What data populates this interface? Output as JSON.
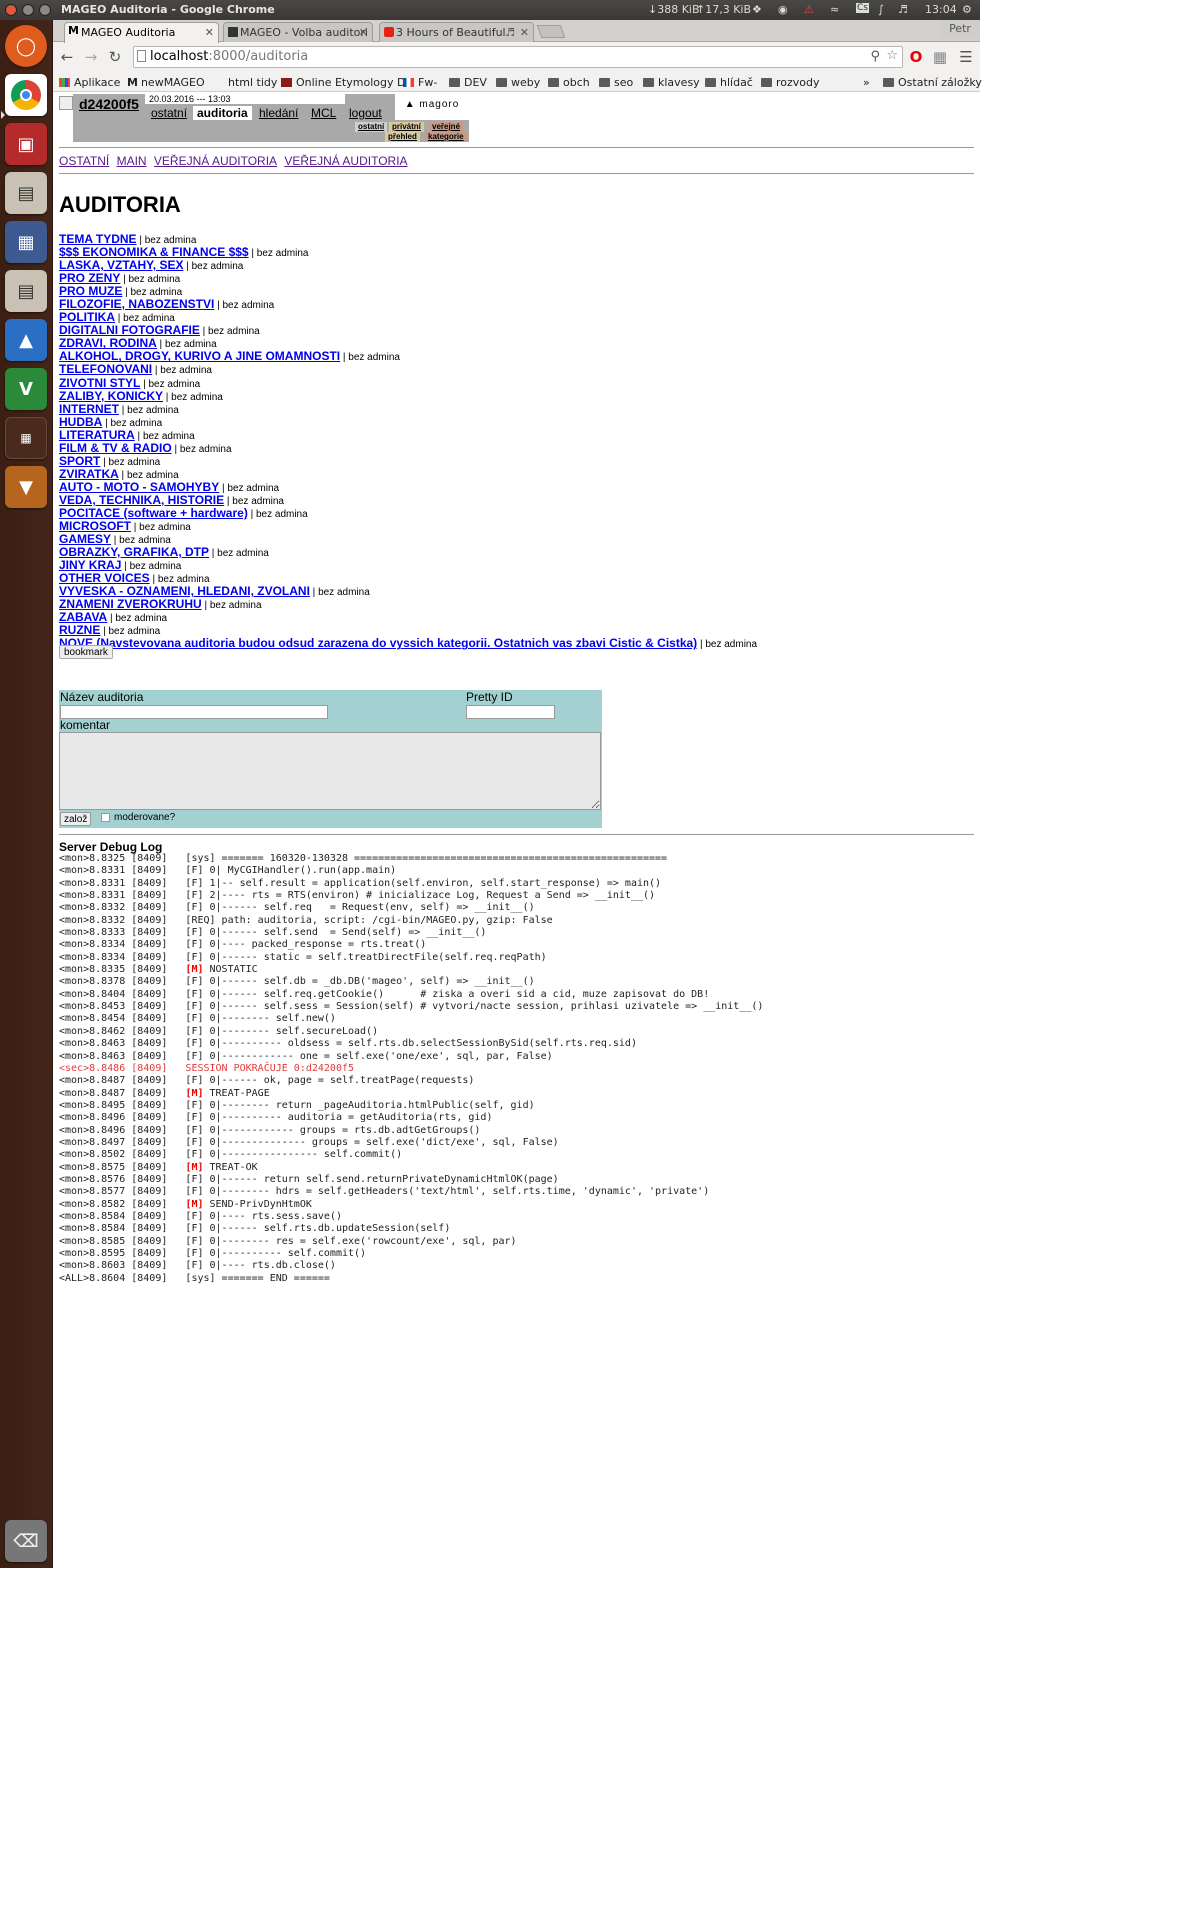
{
  "os": {
    "window_title": "MAGEO Auditoria - Google Chrome",
    "net_down": "↓388 KiB",
    "net_up": "↑17,3 KiB",
    "clock": "13:04"
  },
  "browser": {
    "tabs": [
      {
        "label": "MAGEO Auditoria",
        "active": true
      },
      {
        "label": "MAGEO - Volba auditori",
        "active": false
      },
      {
        "label": "3 Hours of Beautiful",
        "active": false
      }
    ],
    "profile": "Petr",
    "url_host": "localhost",
    "url_path": ":8000/auditoria",
    "bookmarks": [
      "Aplikace",
      "newMAGEO",
      "html tidy",
      "Online Etymology D",
      "Fw-",
      "DEV",
      "weby",
      "obch",
      "seo",
      "klavesy",
      "hlídač",
      "rozvody"
    ],
    "bookmarks_more": "»",
    "other_bookmarks": "Ostatní záložky"
  },
  "header": {
    "sid": "d24200f5",
    "datetime": "20.03.2016 --- 13:03",
    "tabs": [
      "ostatní",
      "auditoria",
      "hledání",
      "MCL",
      "logout"
    ],
    "active_tab": "auditoria",
    "logo": "magoro",
    "sub_links": [
      "ostatní",
      "privátní",
      "veřejné",
      "přehled",
      "kategorie"
    ]
  },
  "breadcrumbs": [
    "OSTATNÍ",
    "MAIN",
    "VEŘEJNÁ AUDITORIA",
    "VEŘEJNÁ AUDITORIA"
  ],
  "page_title": "AUDITORIA",
  "admin_note": "bez admina",
  "auditoria": [
    "TEMA TYDNE",
    "$$$ EKONOMIKA & FINANCE $$$",
    "LASKA, VZTAHY, SEX",
    "PRO ZENY",
    "PRO MUZE",
    "FILOZOFIE, NABOZENSTVI",
    "POLITIKA",
    "DIGITALNI FOTOGRAFIE",
    "ZDRAVI, RODINA",
    "ALKOHOL, DROGY, KURIVO A JINE OMAMNOSTI",
    "TELEFONOVANI",
    "ZIVOTNI STYL",
    "ZALIBY, KONICKY",
    "INTERNET",
    "HUDBA",
    "LITERATURA",
    "FILM & TV & RADIO",
    "SPORT",
    "ZVIRATKA",
    "AUTO - MOTO - SAMOHYBY",
    "VEDA, TECHNIKA, HISTORIE",
    "POCITACE (software + hardware)",
    "MICROSOFT",
    "GAMESY",
    "OBRAZKY, GRAFIKA, DTP",
    "JINY KRAJ",
    "OTHER VOICES",
    "VYVESKA - OZNAMENI, HLEDANI, ZVOLANI",
    "ZNAMENI ZVEROKRUHU",
    "ZABAVA",
    "RUZNE",
    "NOVE (Navstevovana auditoria budou odsud zarazena do vyssich kategorii. Ostatnich vas zbavi Cistic & Cistka)"
  ],
  "bookmark_button": "bookmark",
  "form": {
    "name_label": "Název auditoria",
    "pretty_label": "Pretty ID",
    "comment_label": "komentar",
    "submit": "založ",
    "moderated_label": "moderovane?"
  },
  "debug": {
    "title": "Server Debug Log",
    "lines": [
      {
        "t": "<mon>8.8325 [8409]   [sys] ======= 160320-130328 ===================================================="
      },
      {
        "t": "<mon>8.8331 [8409]   [F] 0| MyCGIHandler().run(app.main)"
      },
      {
        "t": "<mon>8.8331 [8409]   [F] 1|-- self.result = application(self.environ, self.start_response) => main()"
      },
      {
        "t": "<mon>8.8331 [8409]   [F] 2|---- rts = RTS(environ) # inicializace Log, Request a Send => __init__()"
      },
      {
        "t": "<mon>8.8332 [8409]   [F] 0|------ self.req   = Request(env, self) => __init__()"
      },
      {
        "t": "<mon>8.8332 [8409]   [REQ] path: auditoria, script: /cgi-bin/MAGEO.py, gzip: False"
      },
      {
        "t": "<mon>8.8333 [8409]   [F] 0|------ self.send  = Send(self) => __init__()"
      },
      {
        "t": "<mon>8.8334 [8409]   [F] 0|---- packed_response = rts.treat()"
      },
      {
        "t": "<mon>8.8334 [8409]   [F] 0|------ static = self.treatDirectFile(self.req.reqPath)"
      },
      {
        "t": "<mon>8.8335 [8409]   ",
        "m": "[M]",
        "r": " NOSTATIC"
      },
      {
        "t": "<mon>8.8378 [8409]   [F] 0|------ self.db = _db.DB('mageo', self) => __init__()"
      },
      {
        "t": "<mon>8.8404 [8409]   [F] 0|------ self.req.getCookie()      # ziska a overi sid a cid, muze zapisovat do DB!"
      },
      {
        "t": "<mon>8.8453 [8409]   [F] 0|------ self.sess = Session(self) # vytvori/nacte session, prihlasi uzivatele => __init__()"
      },
      {
        "t": "<mon>8.8454 [8409]   [F] 0|-------- self.new()"
      },
      {
        "t": "<mon>8.8462 [8409]   [F] 0|-------- self.secureLoad()"
      },
      {
        "t": "<mon>8.8463 [8409]   [F] 0|---------- oldsess = self.rts.db.selectSessionBySid(self.rts.req.sid)"
      },
      {
        "t": "<mon>8.8463 [8409]   [F] 0|------------ one = self.exe('one/exe', sql, par, False)"
      },
      {
        "t": "<sec>8.8486 [8409]   SESSION POKRAČUJE 0:d24200f5",
        "sec": true
      },
      {
        "t": "<mon>8.8487 [8409]   [F] 0|------ ok, page = self.treatPage(requests)"
      },
      {
        "t": "<mon>8.8487 [8409]   ",
        "m": "[M]",
        "r": " TREAT-PAGE"
      },
      {
        "t": "<mon>8.8495 [8409]   [F] 0|-------- return _pageAuditoria.htmlPublic(self, gid)"
      },
      {
        "t": "<mon>8.8496 [8409]   [F] 0|---------- auditoria = getAuditoria(rts, gid)"
      },
      {
        "t": "<mon>8.8496 [8409]   [F] 0|------------ groups = rts.db.adtGetGroups()"
      },
      {
        "t": "<mon>8.8497 [8409]   [F] 0|-------------- groups = self.exe('dict/exe', sql, False)"
      },
      {
        "t": "<mon>8.8502 [8409]   [F] 0|---------------- self.commit()"
      },
      {
        "t": "<mon>8.8575 [8409]   ",
        "m": "[M]",
        "r": " TREAT-OK"
      },
      {
        "t": "<mon>8.8576 [8409]   [F] 0|------ return self.send.returnPrivateDynamicHtmlOK(page)"
      },
      {
        "t": "<mon>8.8577 [8409]   [F] 0|-------- hdrs = self.getHeaders('text/html', self.rts.time, 'dynamic', 'private')"
      },
      {
        "t": "<mon>8.8582 [8409]   ",
        "m": "[M]",
        "r": " SEND-PrivDynHtmOK"
      },
      {
        "t": "<mon>8.8584 [8409]   [F] 0|---- rts.sess.save()"
      },
      {
        "t": "<mon>8.8584 [8409]   [F] 0|------ self.rts.db.updateSession(self)"
      },
      {
        "t": "<mon>8.8585 [8409]   [F] 0|-------- res = self.exe('rowcount/exe', sql, par)"
      },
      {
        "t": "<mon>8.8595 [8409]   [F] 0|---------- self.commit()"
      },
      {
        "t": "<mon>8.8603 [8409]   [F] 0|---- rts.db.close()"
      },
      {
        "t": "<ALL>8.8604 [8409]   [sys] ======= END ======"
      }
    ]
  }
}
